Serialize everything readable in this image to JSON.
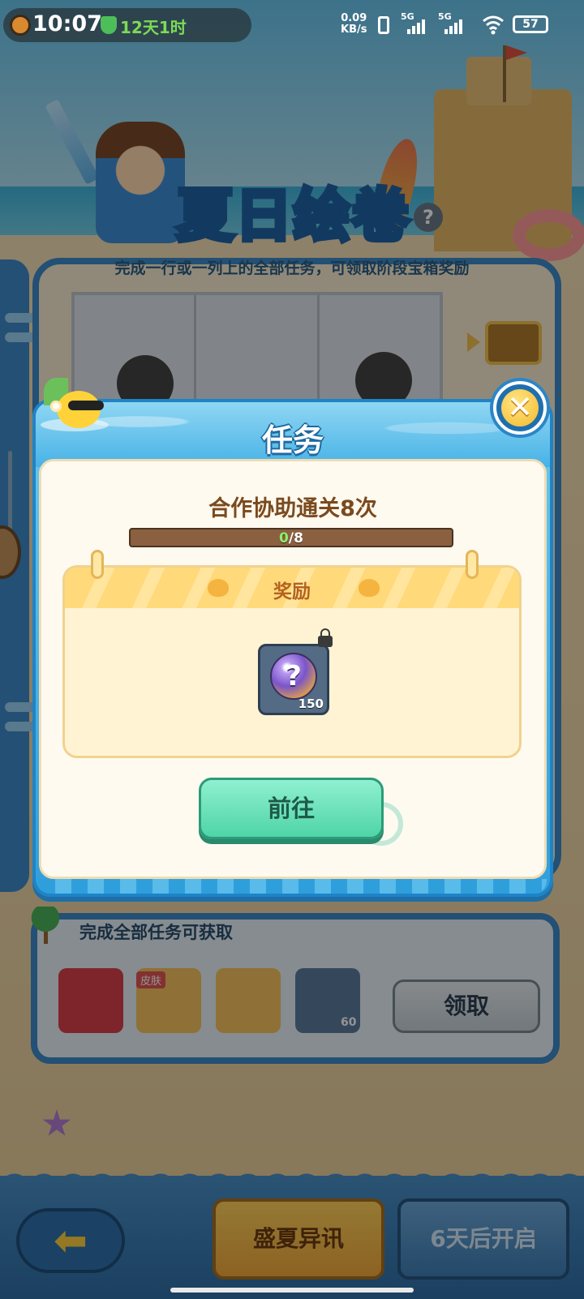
{
  "status_bar": {
    "time": "10:07",
    "countdown": "12天1时",
    "network_speed_value": "0.09",
    "network_speed_unit": "KB/s",
    "signal1": "5G",
    "signal2": "5G",
    "battery": "57"
  },
  "background": {
    "title_art": "夏日绘卷",
    "subtitle": "完成一行或一列上的全部任务，可领取阶段宝箱奖励",
    "rewards_panel_label": "完成全部任务可获取",
    "skin_badge": "皮肤",
    "item_count": "60",
    "claim_button": "领取",
    "bottom_event_button": "盛夏异讯",
    "bottom_later_button": "6天后开启"
  },
  "modal": {
    "title": "任务",
    "task_name": "合作协助通关8次",
    "progress": {
      "current": "0",
      "separator": "/",
      "total": "8",
      "fraction": 0
    },
    "reward_section_title": "奖励",
    "reward_item_quantity": "150",
    "go_button": "前往"
  },
  "colors": {
    "modal_header": "#2f9fdc",
    "go_button": "#4fd4a8",
    "task_text": "#7a4a1e",
    "reward_title": "#b4621e"
  },
  "icons": [
    "clock-icon",
    "shield-icon",
    "vibrate-icon",
    "wifi-icon",
    "battery-icon",
    "close-icon",
    "lock-icon",
    "mystery-orb-icon",
    "duck-icon",
    "back-arrow-icon"
  ]
}
